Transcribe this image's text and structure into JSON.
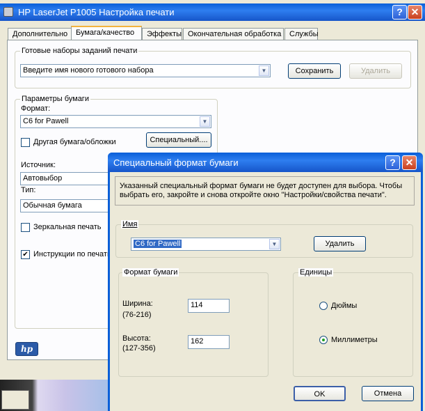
{
  "main_window": {
    "title": "HP LaserJet P1005 Настройка печати",
    "tabs": [
      "Дополнительно",
      "Бумага/качество",
      "Эффекты",
      "Окончательная обработка",
      "Службы"
    ],
    "presets": {
      "group_label": "Готовые наборы заданий печати",
      "placeholder": "Введите имя нового готового набора",
      "save_label": "Сохранить",
      "delete_label": "Удалить"
    },
    "paper": {
      "group_label": "Параметры бумаги",
      "format_label": "Формат:",
      "format_value": "C6 for Pawell",
      "other_paper_label": "Другая бумага/обложки",
      "special_button": "Специальный....",
      "source_label": "Источник:",
      "source_value": "Автовыбор",
      "type_label": "Тип:",
      "type_value": "Обычная бумага",
      "mirror_label": "Зеркальная печать",
      "instructions_label": "Инструкции по печати"
    },
    "logo_text": "hp"
  },
  "dialog": {
    "title": "Специальный формат бумаги",
    "info_text": "Указанный специальный формат бумаги не будет доступен для выбора. Чтобы выбрать его, закройте и снова откройте окно \"Настройки/свойства печати\".",
    "name_group_label": "Имя",
    "name_value": "C6 for Pawell",
    "delete_button": "Удалить",
    "format_group_label": "Формат бумаги",
    "width_label": "Ширина:",
    "width_range": "(76-216)",
    "width_value": "114",
    "height_label": "Высота:",
    "height_range": "(127-356)",
    "height_value": "162",
    "units_group_label": "Единицы",
    "unit_inches": "Дюймы",
    "unit_mm": "Миллиметры",
    "selected_unit": "mm",
    "ok_button": "OK",
    "cancel_button": "Отмена"
  }
}
